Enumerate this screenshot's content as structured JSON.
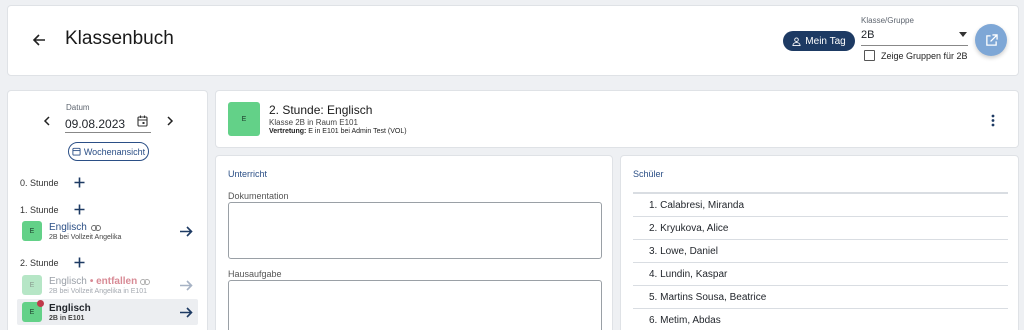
{
  "header": {
    "title": "Klassenbuch",
    "mein_tag_label": "Mein Tag",
    "klasse_label": "Klasse/Gruppe",
    "klasse_value": "2B",
    "gruppen_checkbox_label": "Zeige Gruppen für 2B",
    "gruppen_checked": false
  },
  "sidebar": {
    "datum_label": "Datum",
    "datum_value": "09.08.2023",
    "wochen_label": "Wochenansicht",
    "slots": [
      {
        "label": "0. Stunde"
      },
      {
        "label": "1. Stunde"
      },
      {
        "label": "2. Stunde"
      }
    ],
    "lessons": [
      {
        "abbr": "E",
        "name": "Englisch",
        "sub": "2B bei Vollzeit Angelika"
      },
      {
        "abbr": "E",
        "name": "Englisch",
        "status": "• entfallen",
        "sub": "2B bei Vollzeit Angelika in E101"
      },
      {
        "abbr": "E",
        "name": "Englisch",
        "sub": "2B in E101"
      }
    ]
  },
  "lesson": {
    "abbr": "E",
    "title": "2. Stunde: Englisch",
    "subtitle": "Klasse 2B in Raum E101",
    "vertretung_label": "Vertretung:",
    "vertretung_text": " E in E101 bei Admin Test (VOL)"
  },
  "unterricht": {
    "heading": "Unterricht",
    "doku_label": "Dokumentation",
    "doku_value": "",
    "hausaufgabe_label": "Hausaufgabe",
    "hausaufgabe_value": ""
  },
  "schueler": {
    "heading": "Schüler",
    "items": [
      "1. Calabresi, Miranda",
      "2. Kryukova, Alice",
      "3. Lowe, Daniel",
      "4. Lundin, Kaspar",
      "5. Martins Sousa, Beatrice",
      "6. Metim, Abdas"
    ]
  },
  "colors": {
    "accent": "#1d3a63",
    "fab": "#7ea7d6",
    "subject_green": "#63d188",
    "subject_green_faded": "#b6e6c6",
    "cancel_red": "#c0394a",
    "heading_blue": "#2b4f86"
  }
}
